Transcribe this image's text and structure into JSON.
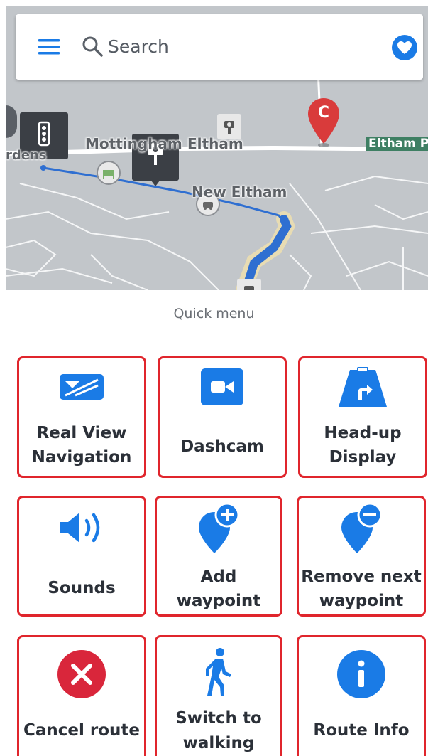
{
  "search": {
    "placeholder": "Search"
  },
  "map": {
    "labels": {
      "gardens": "rdens",
      "mottingham": "Mottingham",
      "eltham": "Eltham",
      "new_eltham": "New Eltham",
      "eltham_right": "Eltham P"
    },
    "waypoint_letter": "C",
    "route_color": "#2f6fd1"
  },
  "quick_menu": {
    "title": "Quick menu",
    "items": [
      {
        "label_1": "Real View",
        "label_2": "Navigation",
        "icon": "real-view-icon"
      },
      {
        "label_1": "Dashcam",
        "icon": "dashcam-icon"
      },
      {
        "label_1": "Head-up",
        "label_2": "Display",
        "icon": "head-up-display-icon"
      },
      {
        "label_1": "Sounds",
        "icon": "sound-icon"
      },
      {
        "label_1": "Add",
        "label_2": "waypoint",
        "icon": "add-waypoint-icon"
      },
      {
        "label_1": "Remove next",
        "label_2": "waypoint",
        "icon": "remove-waypoint-icon"
      },
      {
        "label_1": "Cancel route",
        "icon": "cancel-icon"
      },
      {
        "label_1": "Switch to",
        "label_2": "walking",
        "icon": "walking-icon"
      },
      {
        "label_1": "Route Info",
        "icon": "info-icon"
      }
    ]
  },
  "colors": {
    "accent": "#1a7be6",
    "highlight_border": "#e0252c",
    "cancel": "#d9263b",
    "waypoint_pin": "#d93b3b"
  }
}
